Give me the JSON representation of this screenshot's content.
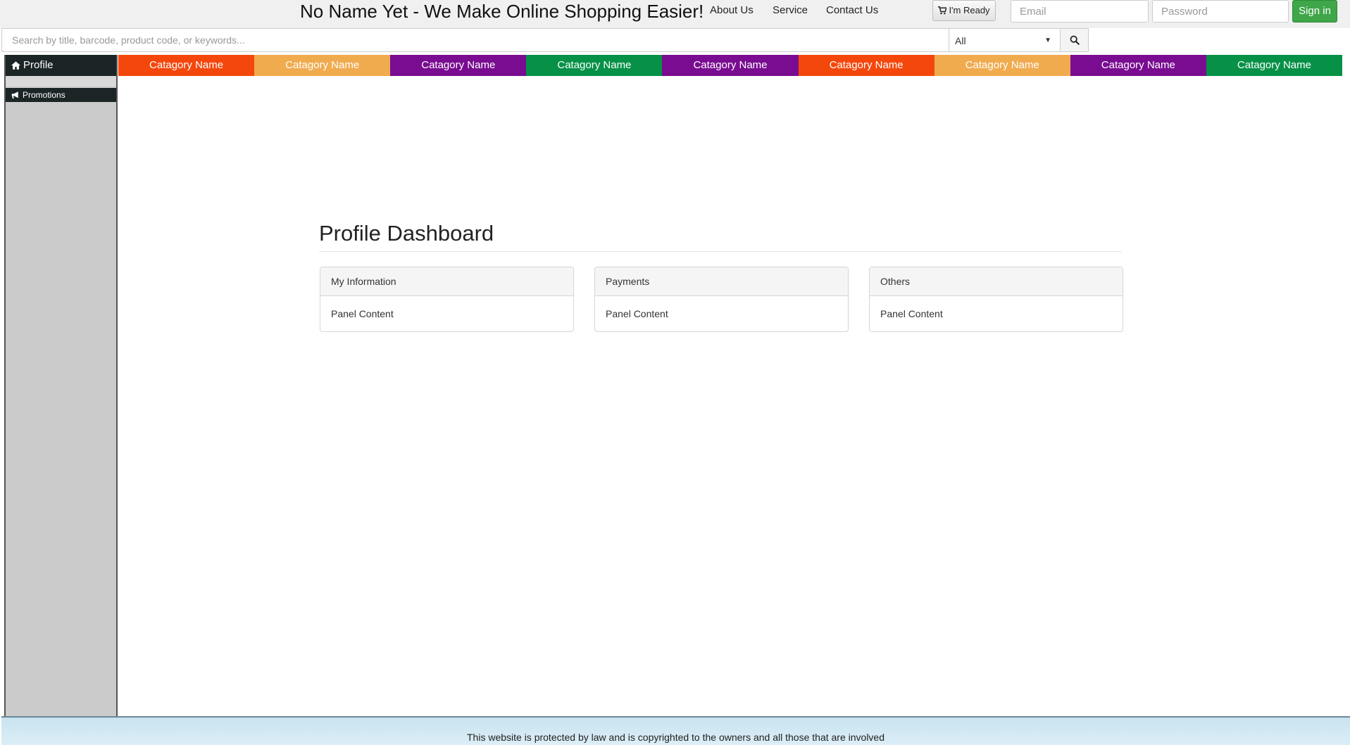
{
  "header": {
    "brand": "No Name Yet - We Make Online Shopping Easier!",
    "nav": [
      "About Us",
      "Service",
      "Contact Us"
    ],
    "ready_button": "I'm Ready",
    "email_placeholder": "Email",
    "password_placeholder": "Password",
    "signin_button": "Sign in"
  },
  "search": {
    "placeholder": "Search by title, barcode, product code, or keywords...",
    "category_selected": "All",
    "button_icon": "search-icon"
  },
  "sidebar": {
    "items": [
      {
        "label": "Profile",
        "icon": "home-icon"
      },
      {
        "label": "Promotions",
        "icon": "bullhorn-icon"
      }
    ]
  },
  "categories": [
    {
      "label": "Catagory Name",
      "color": "#f4470c"
    },
    {
      "label": "Catagory Name",
      "color": "#f0ab4e"
    },
    {
      "label": "Catagory Name",
      "color": "#790c91"
    },
    {
      "label": "Catagory Name",
      "color": "#069147"
    },
    {
      "label": "Catagory Name",
      "color": "#790c91"
    },
    {
      "label": "Catagory Name",
      "color": "#f4470c"
    },
    {
      "label": "Catagory Name",
      "color": "#f0ab4e"
    },
    {
      "label": "Catagory Name",
      "color": "#790c91"
    },
    {
      "label": "Catagory Name",
      "color": "#069147"
    }
  ],
  "main": {
    "title": "Profile Dashboard",
    "panels": [
      {
        "heading": "My Information",
        "body": "Panel Content"
      },
      {
        "heading": "Payments",
        "body": "Panel Content"
      },
      {
        "heading": "Others",
        "body": "Panel Content"
      }
    ]
  },
  "footer": {
    "text": "This website is protected by law and is copyrighted to the owners and all those that are involved"
  }
}
